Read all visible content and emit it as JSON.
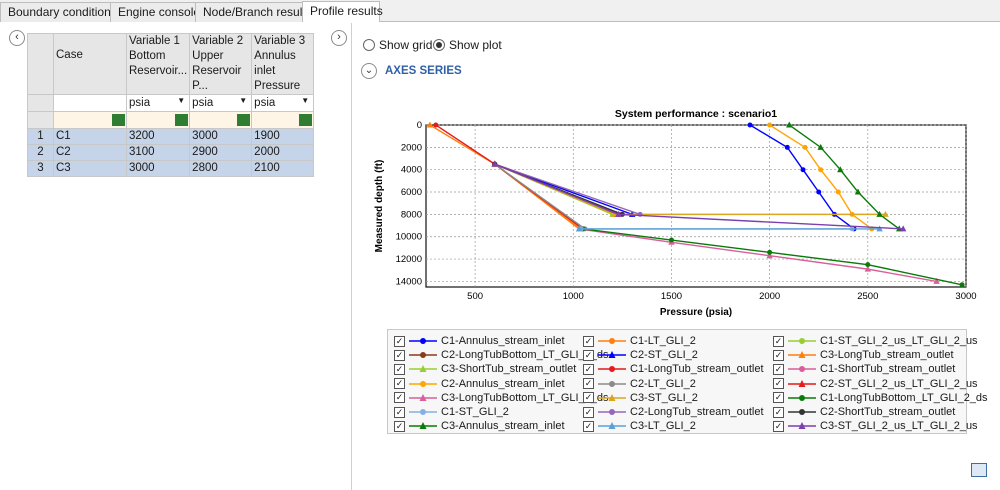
{
  "tabs": [
    "Boundary conditions",
    "Engine console",
    "Node/Branch results",
    "Profile results"
  ],
  "active_tab": 3,
  "grid": {
    "headers": [
      "Case",
      "Variable 1 Bottom Reservoir...",
      "Variable 2 Upper Reservoir P...",
      "Variable 3 Annulus inlet Pressure"
    ],
    "header_lines": [
      [
        "Case"
      ],
      [
        "Variable 1",
        "Bottom",
        "Reservoir..."
      ],
      [
        "Variable 2",
        "Upper",
        "Reservoir P..."
      ],
      [
        "Variable 3",
        "Annulus inlet",
        "Pressure"
      ]
    ],
    "units": [
      "psia",
      "psia",
      "psia"
    ],
    "rows": [
      {
        "num": "1",
        "case": "C1",
        "v1": "3200",
        "v2": "3000",
        "v3": "1900"
      },
      {
        "num": "2",
        "case": "C2",
        "v1": "3100",
        "v2": "2900",
        "v3": "2000"
      },
      {
        "num": "3",
        "case": "C3",
        "v1": "3000",
        "v2": "2800",
        "v3": "2100"
      }
    ]
  },
  "view": {
    "show_grid_label": "Show grid",
    "show_plot_label": "Show plot",
    "selected": "Show plot"
  },
  "axes_series_label": "AXES SERIES",
  "chart_data": {
    "type": "line",
    "title": "System performance : scenario1",
    "xlabel": "Pressure (psia)",
    "ylabel": "Measured depth (ft)",
    "xlim": [
      250,
      3000
    ],
    "ylim": [
      0,
      14500
    ],
    "y_inverted": true,
    "xticks": [
      500,
      1000,
      1500,
      2000,
      2500,
      3000
    ],
    "yticks": [
      0,
      2000,
      4000,
      6000,
      8000,
      10000,
      12000,
      14000
    ],
    "grid": true,
    "series": [
      {
        "name": "C1-Annulus_stream_inlet",
        "color": "#0000ff",
        "marker": "circle",
        "x": [
          1900,
          2090,
          2170,
          2250,
          2330,
          2430
        ],
        "y": [
          0,
          2000,
          4000,
          6000,
          8000,
          9300
        ]
      },
      {
        "name": "C1-LT_GLI_2",
        "color": "#ff7f0e",
        "marker": "circle",
        "x": [
          600,
          1040
        ],
        "y": [
          3500,
          9300
        ]
      },
      {
        "name": "C1-ST_GLI_2_us_LT_GLI_2_us",
        "color": "#9acd32",
        "marker": "circle",
        "x": [
          600,
          1200
        ],
        "y": [
          3500,
          8000
        ]
      },
      {
        "name": "C2-LongTubBottom_LT_GLI_2_ds",
        "color": "#8b3a1a",
        "marker": "circle",
        "x": [
          600,
          1230
        ],
        "y": [
          3500,
          8000
        ]
      },
      {
        "name": "C2-ST_GLI_2",
        "color": "#0000ff",
        "marker": "triangle",
        "x": [
          600,
          1300
        ],
        "y": [
          3500,
          8000
        ]
      },
      {
        "name": "C3-LongTub_stream_outlet",
        "color": "#ff7f0e",
        "marker": "triangle",
        "x": [
          270,
          600,
          1030
        ],
        "y": [
          0,
          3500,
          9300
        ]
      },
      {
        "name": "C3-ShortTub_stream_outlet",
        "color": "#9acd32",
        "marker": "triangle",
        "x": [
          600,
          1200
        ],
        "y": [
          3500,
          8000
        ]
      },
      {
        "name": "C1-LongTub_stream_outlet",
        "color": "#e41a1c",
        "marker": "circle",
        "x": [
          300,
          600,
          1050
        ],
        "y": [
          0,
          3500,
          9300
        ]
      },
      {
        "name": "C1-ShortTub_stream_outlet",
        "color": "#d95f9b",
        "marker": "circle",
        "x": [
          600,
          1240
        ],
        "y": [
          3500,
          8000
        ]
      },
      {
        "name": "C2-Annulus_stream_inlet",
        "color": "#ffa500",
        "marker": "circle",
        "x": [
          2000,
          2180,
          2260,
          2350,
          2420,
          2520
        ],
        "y": [
          0,
          2000,
          4000,
          6000,
          8000,
          9300
        ]
      },
      {
        "name": "C2-LT_GLI_2",
        "color": "#8a8a8a",
        "marker": "circle",
        "x": [
          600,
          1060
        ],
        "y": [
          3500,
          9300
        ]
      },
      {
        "name": "C2-ST_GLI_2_us_LT_GLI_2_us",
        "color": "#e41a1c",
        "marker": "triangle",
        "x": [
          600,
          1220
        ],
        "y": [
          3500,
          8000
        ]
      },
      {
        "name": "C3-LongTubBottom_LT_GLI_2_ds",
        "color": "#d95f9b",
        "marker": "triangle",
        "x": [
          1030,
          1500,
          2000,
          2500,
          2850
        ],
        "y": [
          9300,
          10500,
          11700,
          12900,
          14000
        ]
      },
      {
        "name": "C3-ST_GLI_2",
        "color": "#daa520",
        "marker": "triangle",
        "x": [
          600,
          1210,
          2590
        ],
        "y": [
          3500,
          8000,
          8000
        ]
      },
      {
        "name": "C1-LongTubBottom_LT_GLI_2_ds",
        "color": "#0a7a0a",
        "marker": "circle",
        "x": [
          1050,
          1500,
          2000,
          2500,
          2980
        ],
        "y": [
          9300,
          10300,
          11400,
          12500,
          14300
        ]
      },
      {
        "name": "C1-ST_GLI_2",
        "color": "#87aee8",
        "marker": "circle",
        "x": [
          1040,
          2420
        ],
        "y": [
          9300,
          9300
        ]
      },
      {
        "name": "C2-LongTub_stream_outlet",
        "color": "#9467bd",
        "marker": "circle",
        "x": [
          600,
          1340
        ],
        "y": [
          3500,
          8000
        ]
      },
      {
        "name": "C2-ShortTub_stream_outlet",
        "color": "#333333",
        "marker": "circle",
        "x": [
          600,
          1250
        ],
        "y": [
          3500,
          8000
        ]
      },
      {
        "name": "C3-Annulus_stream_inlet",
        "color": "#0a7a0a",
        "marker": "triangle",
        "x": [
          2100,
          2260,
          2360,
          2450,
          2560,
          2660
        ],
        "y": [
          0,
          2000,
          4000,
          6000,
          8000,
          9300
        ]
      },
      {
        "name": "C3-LT_GLI_2",
        "color": "#5aa0d8",
        "marker": "triangle",
        "x": [
          1030,
          2560
        ],
        "y": [
          9300,
          9300
        ]
      },
      {
        "name": "C3-ST_GLI_2_us_LT_GLI_2_us",
        "color": "#7b3fb0",
        "marker": "triangle",
        "x": [
          600,
          1230,
          2680
        ],
        "y": [
          3500,
          8000,
          9300
        ]
      }
    ]
  },
  "legend_checked": true,
  "legend_check_glyph": "✓"
}
